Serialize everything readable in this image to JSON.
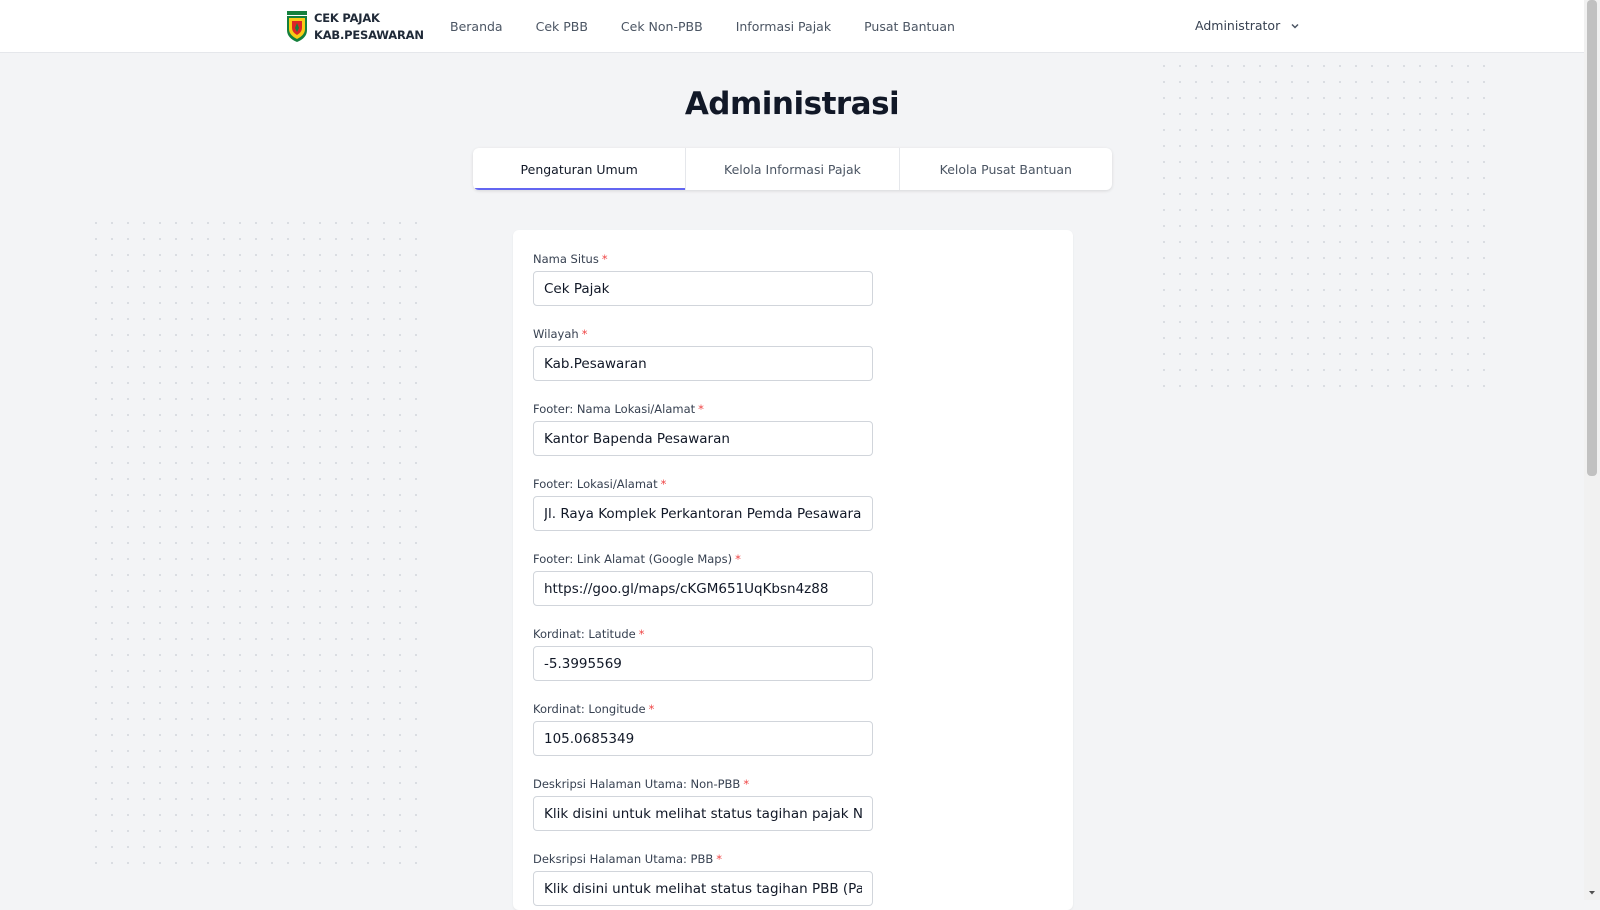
{
  "header": {
    "brand_line1": "CEK PAJAK",
    "brand_line2": "KAB.PESAWARAN",
    "nav": [
      {
        "label": "Beranda"
      },
      {
        "label": "Cek PBB"
      },
      {
        "label": "Cek Non-PBB"
      },
      {
        "label": "Informasi Pajak"
      },
      {
        "label": "Pusat Bantuan"
      }
    ],
    "user_label": "Administrator"
  },
  "page": {
    "title": "Administrasi"
  },
  "tabs": [
    {
      "label": "Pengaturan Umum",
      "active": true
    },
    {
      "label": "Kelola Informasi Pajak",
      "active": false
    },
    {
      "label": "Kelola Pusat Bantuan",
      "active": false
    }
  ],
  "form": {
    "required_mark": "*",
    "fields": [
      {
        "label": "Nama Situs",
        "value": "Cek Pajak"
      },
      {
        "label": "Wilayah",
        "value": "Kab.Pesawaran"
      },
      {
        "label": "Footer: Nama Lokasi/Alamat",
        "value": "Kantor Bapenda Pesawaran"
      },
      {
        "label": "Footer: Lokasi/Alamat",
        "value": "Jl. Raya Komplek Perkantoran Pemda Pesawaran, K"
      },
      {
        "label": "Footer: Link Alamat (Google Maps)",
        "value": "https://goo.gl/maps/cKGM651UqKbsn4z88"
      },
      {
        "label": "Kordinat: Latitude",
        "value": "-5.3995569"
      },
      {
        "label": "Kordinat: Longitude",
        "value": "105.0685349"
      },
      {
        "label": "Deskripsi Halaman Utama: Non-PBB",
        "value": "Klik disini untuk melihat status tagihan pajak Non-PBB"
      },
      {
        "label": "Deksripsi Halaman Utama: PBB",
        "value": "Klik disini untuk melihat status tagihan PBB (Pajak Bumi dan Bangunan)"
      }
    ]
  },
  "colors": {
    "accent": "#6366f1",
    "required": "#ef4444",
    "page_bg": "#f3f4f6",
    "logo_green": "#15803d",
    "logo_yellow": "#facc15",
    "logo_red": "#dc2626"
  },
  "icons": {
    "brand": "shield-emblem-icon",
    "user_menu": "chevron-down-icon",
    "scroll_down": "arrow-down-icon"
  }
}
